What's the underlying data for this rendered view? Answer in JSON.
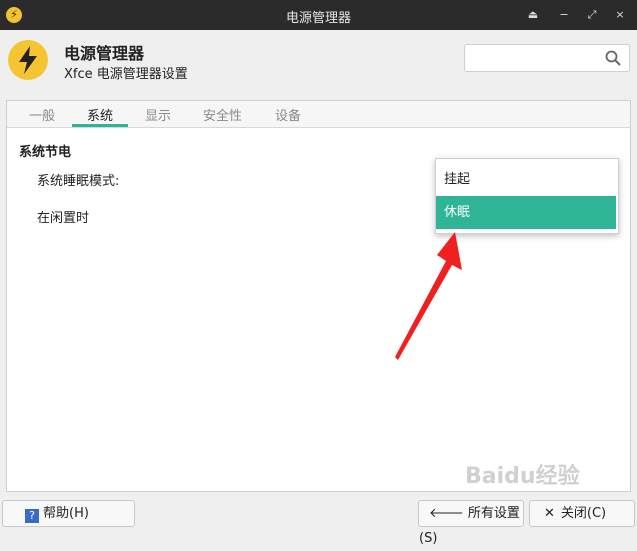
{
  "window": {
    "title": "电源管理器",
    "controls": [
      "⏏",
      "−",
      "⤢",
      "×"
    ]
  },
  "header": {
    "title": "电源管理器",
    "subtitle": "Xfce 电源管理器设置",
    "search_placeholder": ""
  },
  "tabs": [
    {
      "label": "一般",
      "active": false
    },
    {
      "label": "系统",
      "active": true
    },
    {
      "label": "显示",
      "active": false
    },
    {
      "label": "安全性",
      "active": false
    },
    {
      "label": "设备",
      "active": false
    }
  ],
  "content": {
    "section_title": "系统节电",
    "row1_label": "系统睡眠模式:",
    "row2_label": "在闲置时"
  },
  "dropdown": {
    "options": [
      {
        "label": "挂起",
        "selected": false
      },
      {
        "label": "休眠",
        "selected": true
      }
    ],
    "highlight_color": "#2fb596"
  },
  "buttons": {
    "help": "帮助(H)",
    "all_settings": "所有设置(S)",
    "close": "关闭(C)"
  },
  "watermark": "Baidu经验",
  "colors": {
    "accent": "#2fb596",
    "titlebar": "#2b2b2b",
    "icon_yellow": "#f5c431",
    "annotation_arrow": "#f02020"
  }
}
